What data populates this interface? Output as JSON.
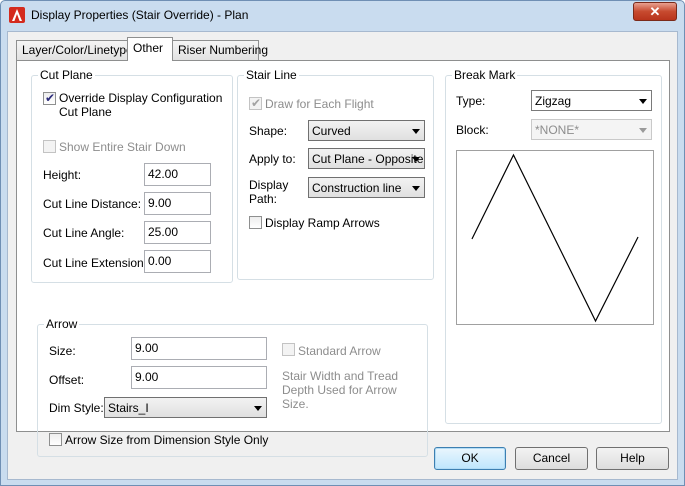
{
  "window": {
    "title": "Display Properties (Stair Override) - Plan",
    "close_glyph": "✕"
  },
  "tabs": [
    {
      "label": "Layer/Color/Linetype",
      "active": false
    },
    {
      "label": "Other",
      "active": true
    },
    {
      "label": "Riser Numbering",
      "active": false
    }
  ],
  "cut_plane": {
    "title": "Cut Plane",
    "override_label": "Override Display Configuration Cut Plane",
    "override_checked": true,
    "show_entire_label": "Show Entire Stair Down",
    "show_entire_checked": false,
    "height_label": "Height:",
    "height_value": "42.00",
    "cut_line_distance_label": "Cut Line Distance:",
    "cut_line_distance_value": "9.00",
    "cut_line_angle_label": "Cut Line Angle:",
    "cut_line_angle_value": "25.00",
    "cut_line_extension_label": "Cut Line Extension:",
    "cut_line_extension_value": "0.00"
  },
  "stair_line": {
    "title": "Stair Line",
    "draw_each_flight_label": "Draw for Each Flight",
    "draw_each_flight_checked": true,
    "shape_label": "Shape:",
    "shape_value": "Curved",
    "apply_to_label": "Apply to:",
    "apply_to_value": "Cut Plane - Opposite",
    "display_path_label": "Display Path:",
    "display_path_value": "Construction line",
    "display_ramp_arrows_label": "Display Ramp Arrows",
    "display_ramp_arrows_checked": false
  },
  "break_mark": {
    "title": "Break Mark",
    "type_label": "Type:",
    "type_value": "Zigzag",
    "block_label": "Block:",
    "block_value": "*NONE*",
    "preview_icon": "zigzag-break-mark-icon"
  },
  "arrow": {
    "title": "Arrow",
    "size_label": "Size:",
    "size_value": "9.00",
    "offset_label": "Offset:",
    "offset_value": "9.00",
    "dim_style_label": "Dim Style:",
    "dim_style_value": "Stairs_I",
    "arrow_size_dim_label": "Arrow Size from Dimension Style Only",
    "arrow_size_dim_checked": false,
    "standard_arrow_label": "Standard Arrow",
    "standard_arrow_checked": false,
    "note_text": "Stair Width and Tread Depth Used for Arrow Size."
  },
  "buttons": {
    "ok": "OK",
    "cancel": "Cancel",
    "help": "Help"
  },
  "colors": {
    "title_bar": "#c9dcef",
    "close_button": "#c74a2f",
    "default_button": "#3c7fb1"
  }
}
